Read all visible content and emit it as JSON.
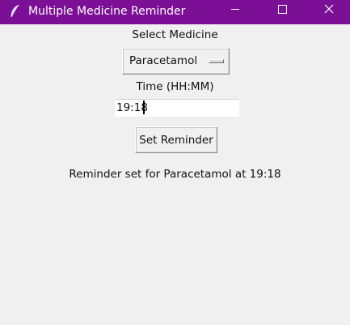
{
  "window": {
    "title": "Multiple Medicine Reminder",
    "titlebar_color": "#7b0f95",
    "icon": "feather-icon"
  },
  "form": {
    "select_label": "Select Medicine",
    "selected_medicine": "Paracetamol",
    "time_label": "Time (HH:MM)",
    "time_value": "19:18",
    "button_label": "Set Reminder"
  },
  "status": {
    "message": "Reminder set for Paracetamol at 19:18"
  }
}
